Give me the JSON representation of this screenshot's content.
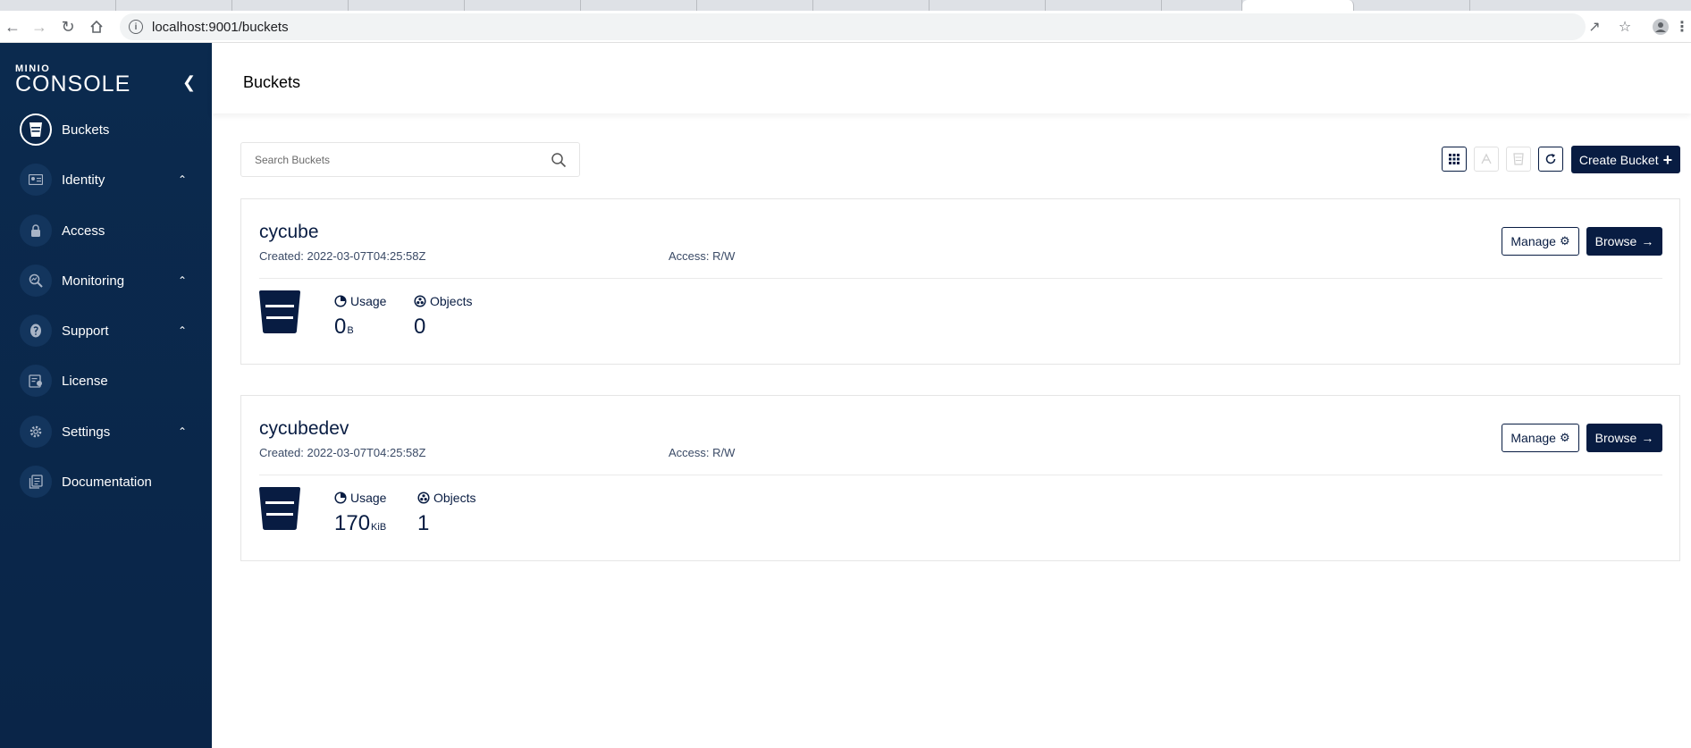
{
  "browser": {
    "url": "localhost:9001/buckets"
  },
  "sidebar": {
    "logo_small": "MINIO",
    "logo_big": "CONSOLE",
    "items": [
      {
        "label": "Buckets",
        "icon": "bucket-icon",
        "active": true,
        "expandable": false
      },
      {
        "label": "Identity",
        "icon": "identity-card-icon",
        "active": false,
        "expandable": true
      },
      {
        "label": "Access",
        "icon": "lock-icon",
        "active": false,
        "expandable": false
      },
      {
        "label": "Monitoring",
        "icon": "magnifier-chart-icon",
        "active": false,
        "expandable": true
      },
      {
        "label": "Support",
        "icon": "support-icon",
        "active": false,
        "expandable": true
      },
      {
        "label": "License",
        "icon": "license-icon",
        "active": false,
        "expandable": false
      },
      {
        "label": "Settings",
        "icon": "gear-icon",
        "active": false,
        "expandable": true
      },
      {
        "label": "Documentation",
        "icon": "documentation-icon",
        "active": false,
        "expandable": false
      }
    ]
  },
  "header": {
    "title": "Buckets"
  },
  "toolbar": {
    "search_placeholder": "Search Buckets",
    "create_label": "Create Bucket"
  },
  "buckets": [
    {
      "name": "cycube",
      "created": "Created: 2022-03-07T04:25:58Z",
      "access": "Access: R/W",
      "manage_label": "Manage",
      "browse_label": "Browse",
      "usage_label": "Usage",
      "usage_value": "0",
      "usage_unit": "B",
      "objects_label": "Objects",
      "objects_value": "0"
    },
    {
      "name": "cycubedev",
      "created": "Created: 2022-03-07T04:25:58Z",
      "access": "Access: R/W",
      "manage_label": "Manage",
      "browse_label": "Browse",
      "usage_label": "Usage",
      "usage_value": "170",
      "usage_unit": "KiB",
      "objects_label": "Objects",
      "objects_value": "1"
    }
  ],
  "colors": {
    "brand": "#081c42",
    "sidebar": "#0b2a4e"
  }
}
